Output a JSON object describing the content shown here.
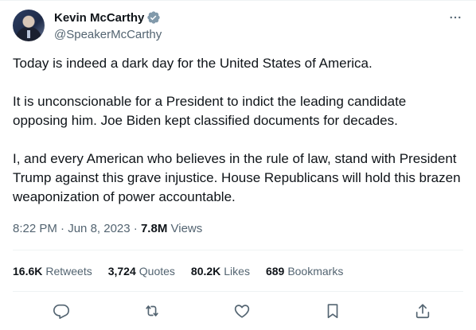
{
  "author": {
    "name": "Kevin McCarthy",
    "handle": "@SpeakerMcCarthy",
    "verified_color": "#829aab"
  },
  "tweet": {
    "paragraphs": [
      "Today is indeed a dark day for the United States of America.",
      "It is unconscionable for a President to indict the leading candidate opposing him. Joe Biden kept classified documents for decades.",
      "I, and every American who believes in the rule of law, stand with President Trump against this grave injustice. House Republicans will hold this brazen weaponization of power accountable."
    ],
    "time": "8:22 PM",
    "separator": "·",
    "date": "Jun 8, 2023",
    "views_count": "7.8M",
    "views_label": "Views"
  },
  "stats": {
    "retweets_count": "16.6K",
    "retweets_label": "Retweets",
    "quotes_count": "3,724",
    "quotes_label": "Quotes",
    "likes_count": "80.2K",
    "likes_label": "Likes",
    "bookmarks_count": "689",
    "bookmarks_label": "Bookmarks"
  },
  "icons": {
    "more": "more-horizontal-icon",
    "reply": "reply-icon",
    "retweet": "retweet-icon",
    "like": "heart-icon",
    "bookmark": "bookmark-icon",
    "share": "share-icon"
  },
  "colors": {
    "text": "#0f1419",
    "secondary": "#536471",
    "divider": "#eff3f4"
  }
}
